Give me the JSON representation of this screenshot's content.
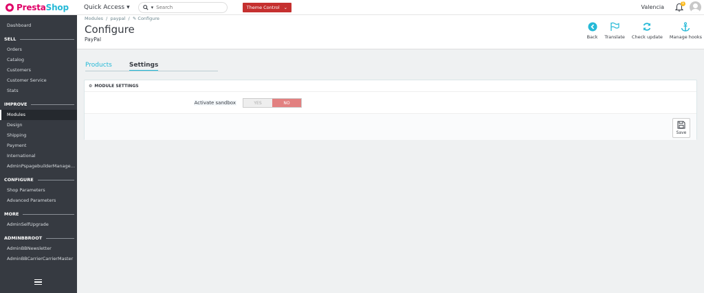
{
  "topbar": {
    "logo_prefix": "Presta",
    "logo_suffix": "Shop",
    "quick_access": "Quick Access",
    "search_placeholder": "Search",
    "theme_control": "Theme Control",
    "user_name": "Valencia",
    "notification_count": "1"
  },
  "sidebar": {
    "dashboard": "Dashboard",
    "sections": [
      {
        "title": "SELL",
        "items": [
          "Orders",
          "Catalog",
          "Customers",
          "Customer Service",
          "Stats"
        ]
      },
      {
        "title": "IMPROVE",
        "items": [
          "Modules",
          "Design",
          "Shipping",
          "Payment",
          "International",
          "AdminPspagebuilderManagem..."
        ]
      },
      {
        "title": "CONFIGURE",
        "items": [
          "Shop Parameters",
          "Advanced Parameters"
        ]
      },
      {
        "title": "MORE",
        "items": [
          "AdminSelfUpgrade"
        ]
      },
      {
        "title": "ADMINBBROOT",
        "items": [
          "AdminBBNewsletter",
          "AdminBBCarrierCarrierMaster"
        ]
      }
    ],
    "active_item": "Modules"
  },
  "header": {
    "breadcrumb_1": "Modules",
    "breadcrumb_2": "paypal",
    "breadcrumb_3": "Configure",
    "title": "Configure",
    "subtitle": "PayPal",
    "toolbar": {
      "back": "Back",
      "translate": "Translate",
      "check_update": "Check update",
      "manage_hooks": "Manage hooks"
    }
  },
  "tabs": {
    "products": "Products",
    "settings": "Settings"
  },
  "panel": {
    "heading": "MODULE SETTINGS",
    "sandbox_label": "Activate sandbox",
    "yes_label": "YES",
    "no_label": "NO",
    "save_label": "Save"
  },
  "colors": {
    "accent": "#25b9d7",
    "sidebar": "#363a41",
    "theme_button": "#c5302f",
    "switch_no": "#e28080"
  }
}
